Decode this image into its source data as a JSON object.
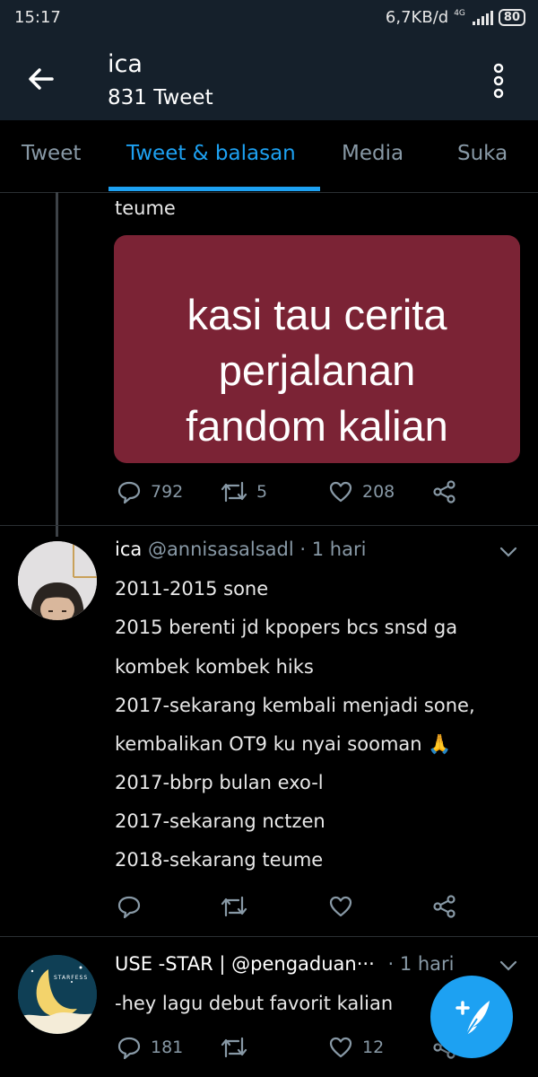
{
  "status_bar": {
    "time": "15:17",
    "net_speed": "6,7KB/d",
    "network": "4G",
    "battery": "80"
  },
  "header": {
    "title": "ica",
    "subtitle": "831 Tweet"
  },
  "tabs": [
    "Tweet",
    "Tweet & balasan",
    "Media",
    "Suka"
  ],
  "active_tab": "Tweet & balasan",
  "tweet1": {
    "text_tail": "teume",
    "image_text": "kasi tau cerita\nperjalanan\nfandom kalian",
    "image_bg": "#7b2335",
    "replies": "792",
    "retweets": "5",
    "likes": "208"
  },
  "tweet2": {
    "name": "ica",
    "handle": "@annisasalsadl",
    "sep": "·",
    "time": "1 hari",
    "lines": [
      "2011-2015 sone",
      "2015 berenti jd kpopers bcs snsd ga",
      "kombek kombek hiks",
      "2017-sekarang kembali menjadi sone,",
      "kembalikan OT9 ku nyai sooman 🙏",
      "2017-bbrp bulan exo-l",
      "2017-sekarang nctzen",
      "2018-sekarang teume"
    ]
  },
  "tweet3": {
    "name": "USE -STAR |",
    "handle": "@pengaduan···",
    "sep": "·",
    "time": "1 hari",
    "text": "-hey lagu debut favorit kalian",
    "avatar_label": "STARFESS",
    "replies": "181",
    "likes": "12"
  },
  "colors": {
    "accent": "#1da1f2",
    "header_bg": "#15202b",
    "muted": "#8899a6"
  },
  "icons": [
    "back-arrow-icon",
    "more-vertical-icon",
    "reply-icon",
    "retweet-icon",
    "like-icon",
    "share-icon",
    "chevron-down-icon",
    "compose-icon"
  ]
}
